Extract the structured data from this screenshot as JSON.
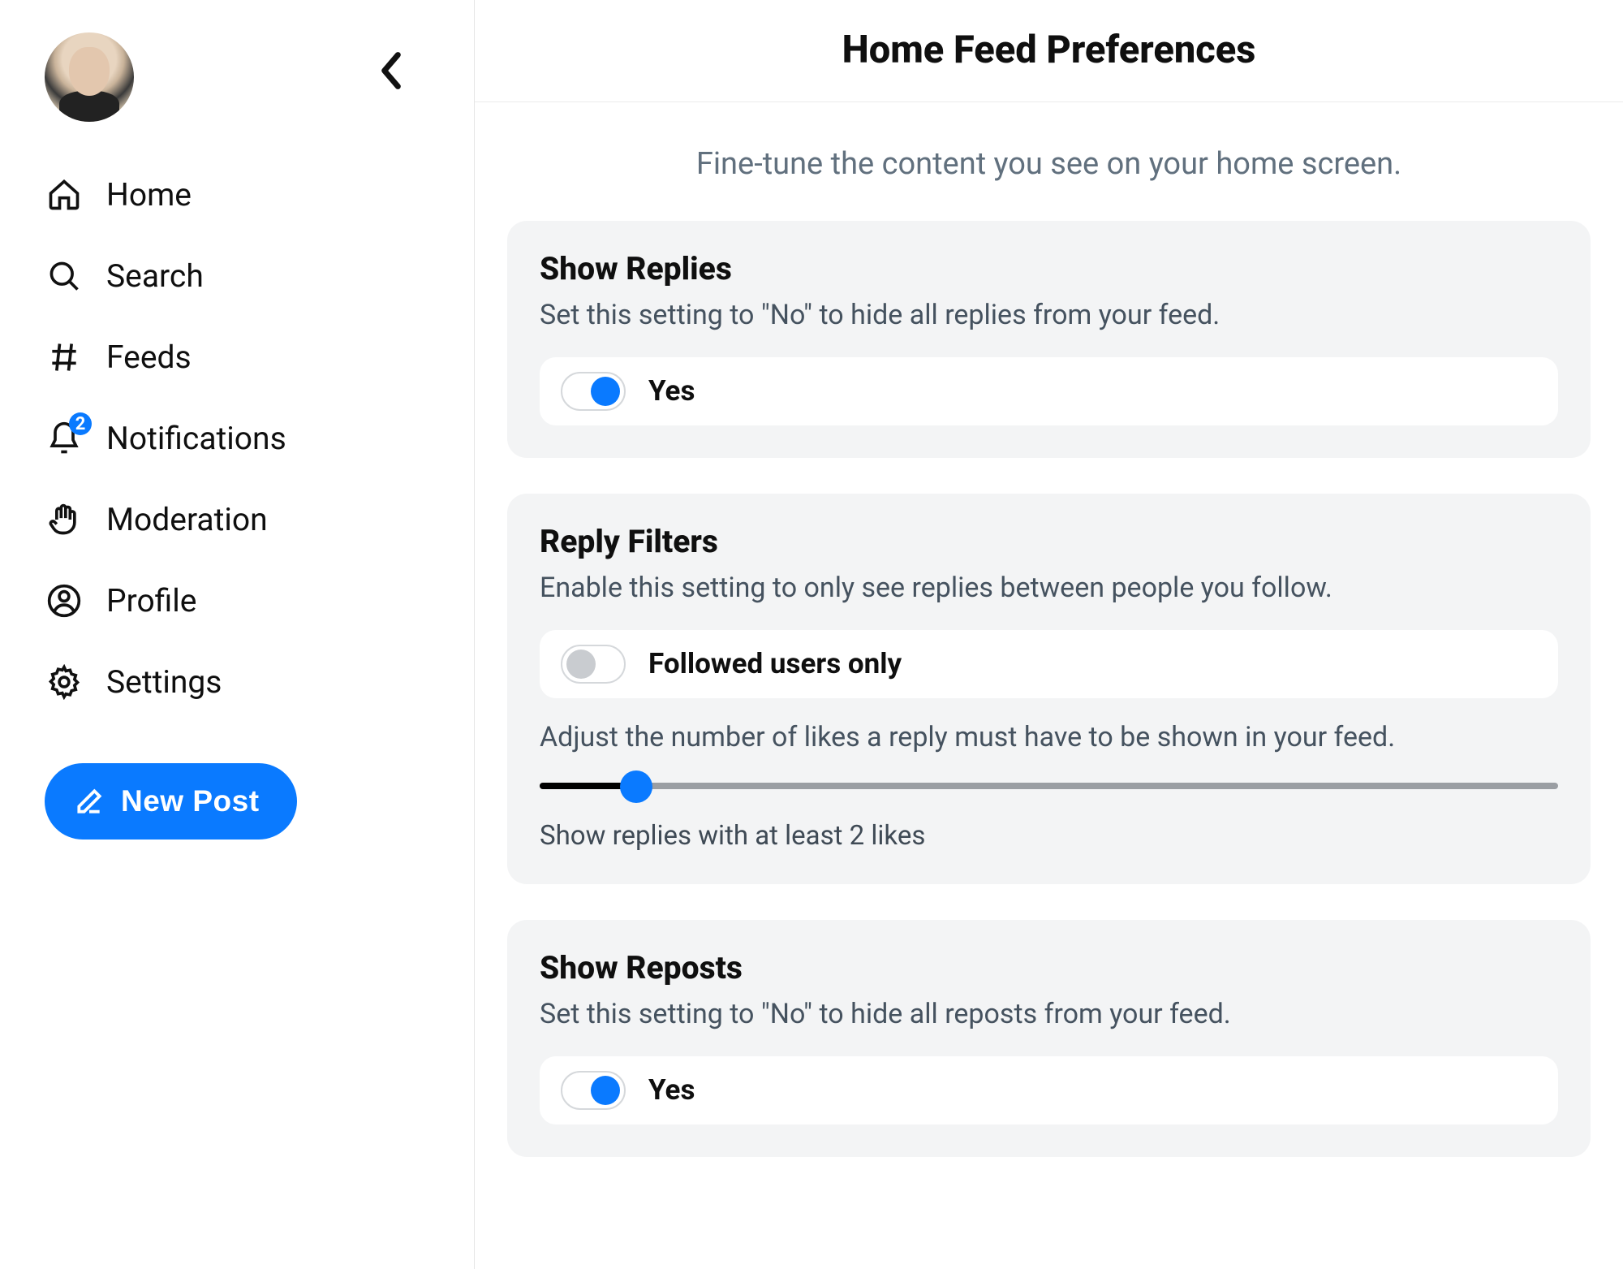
{
  "sidebar": {
    "items": [
      {
        "id": "home",
        "label": "Home"
      },
      {
        "id": "search",
        "label": "Search"
      },
      {
        "id": "feeds",
        "label": "Feeds"
      },
      {
        "id": "notifications",
        "label": "Notifications",
        "badge": "2"
      },
      {
        "id": "moderation",
        "label": "Moderation"
      },
      {
        "id": "profile",
        "label": "Profile"
      },
      {
        "id": "settings",
        "label": "Settings"
      }
    ],
    "new_post_label": "New Post"
  },
  "header": {
    "title": "Home Feed Preferences",
    "subtitle": "Fine-tune the content you see on your home screen."
  },
  "sections": {
    "show_replies": {
      "title": "Show Replies",
      "description": "Set this setting to \"No\" to hide all replies from your feed.",
      "toggle_on": true,
      "toggle_label": "Yes"
    },
    "reply_filters": {
      "title": "Reply Filters",
      "description": "Enable this setting to only see replies between people you follow.",
      "toggle_on": false,
      "toggle_label": "Followed users only",
      "slider_description": "Adjust the number of likes a reply must have to be shown in your feed.",
      "slider_value": 2,
      "slider_caption": "Show replies with at least 2 likes"
    },
    "show_reposts": {
      "title": "Show Reposts",
      "description": "Set this setting to \"No\" to hide all reposts from your feed.",
      "toggle_on": true,
      "toggle_label": "Yes"
    }
  },
  "colors": {
    "accent": "#0a7aff",
    "panel_bg": "#f3f4f5",
    "muted_text": "#61707e"
  }
}
